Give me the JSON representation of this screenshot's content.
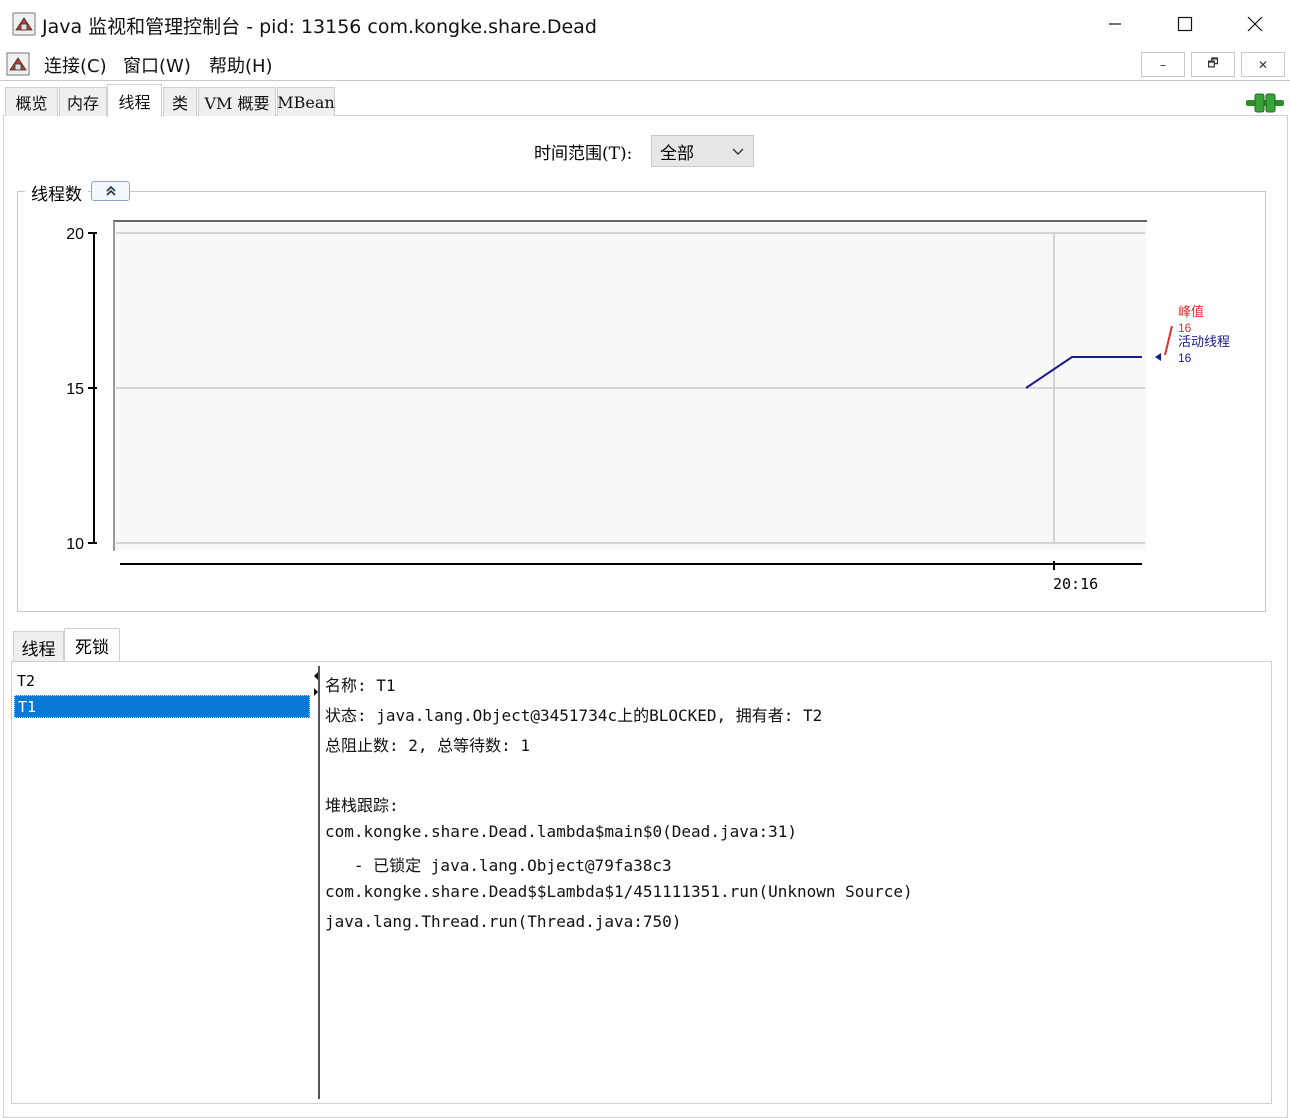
{
  "window": {
    "title": "Java 监视和管理控制台 - pid: 13156 com.kongke.share.Dead"
  },
  "menu": {
    "items": [
      "连接(C)",
      "窗口(W)",
      "帮助(H)"
    ],
    "mdi_buttons": [
      "–",
      "🗗",
      "✕"
    ]
  },
  "tabs": [
    "概览",
    "内存",
    "线程",
    "类",
    "VM 概要",
    "MBean"
  ],
  "active_tab": "线程",
  "time_range": {
    "label": "时间范围(T):",
    "value": "全部"
  },
  "chart_panel": {
    "title": "线程数"
  },
  "chart_data": {
    "type": "line",
    "title": "线程数",
    "ylim": [
      10,
      20
    ],
    "yticks": [
      "20",
      "15",
      "10"
    ],
    "xticks": [
      "20:16"
    ],
    "grid": true,
    "series": [
      {
        "name": "活动线程",
        "color": "#1a1a8c",
        "points": [
          [
            0,
            15
          ],
          [
            1,
            16
          ],
          [
            2,
            16
          ]
        ]
      }
    ],
    "legend": {
      "peak_label": "峰值",
      "peak_value": "16",
      "live_label": "活动线程",
      "live_value": "16",
      "peak_color": "#e03030",
      "live_color": "#1a1a8c"
    }
  },
  "sub_tabs": [
    "线程",
    "死锁"
  ],
  "active_sub_tab": "死锁",
  "thread_list": [
    "T2",
    "T1"
  ],
  "selected_thread": "T1",
  "detail": {
    "lines": [
      "名称: T1",
      "状态: java.lang.Object@3451734c上的BLOCKED, 拥有者: T2",
      "总阻止数: 2, 总等待数: 1",
      "",
      "堆栈跟踪:",
      "com.kongke.share.Dead.lambda$main$0(Dead.java:31)",
      "   - 已锁定 java.lang.Object@79fa38c3",
      "com.kongke.share.Dead$$Lambda$1/451111351.run(Unknown Source)",
      "java.lang.Thread.run(Thread.java:750)"
    ]
  },
  "colors": {
    "selection": "#0a78d7",
    "connected_icon": "#3aa23a"
  }
}
